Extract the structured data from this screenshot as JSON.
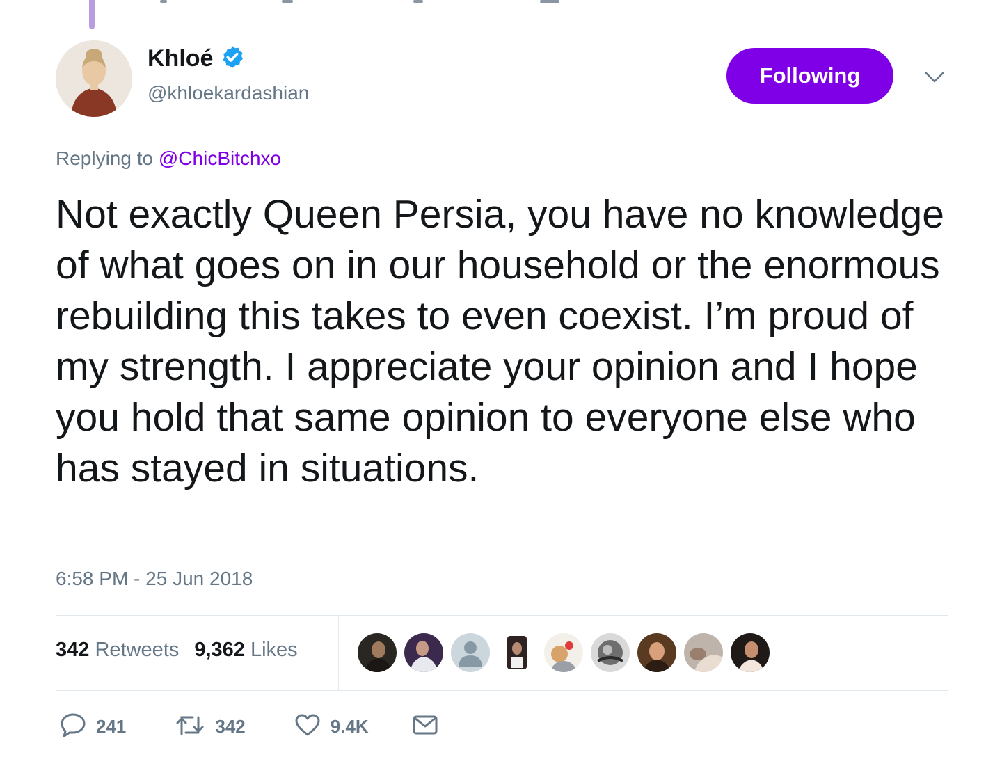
{
  "author": {
    "name": "Khloé",
    "handle": "@khloekardashian",
    "verified": true
  },
  "follow_button": {
    "label": "Following"
  },
  "reply": {
    "prefix": "Replying to",
    "mention": "@ChicBitchxo"
  },
  "tweet": {
    "text": "Not exactly Queen Persia, you have no knowledge of what goes on in our household or the enormous rebuilding this takes to even coexist. I’m proud of my strength. I appreciate your opinion and I hope you hold that same opinion to everyone else who has stayed in situations.",
    "timestamp": "6:58 PM - 25 Jun 2018"
  },
  "stats": {
    "retweets_num": "342",
    "retweets_label": "Retweets",
    "likes_num": "9,362",
    "likes_label": "Likes"
  },
  "actions": {
    "reply_count": "241",
    "retweet_count": "342",
    "like_count": "9.4K"
  },
  "colors": {
    "accent": "#7f00e6",
    "secondary_text": "#657786",
    "divider": "#e1e8ed",
    "verified": "#1da1f2"
  },
  "icons": [
    "verified-badge-icon",
    "chevron-down-icon",
    "reply-icon",
    "retweet-icon",
    "heart-icon",
    "mail-icon"
  ]
}
